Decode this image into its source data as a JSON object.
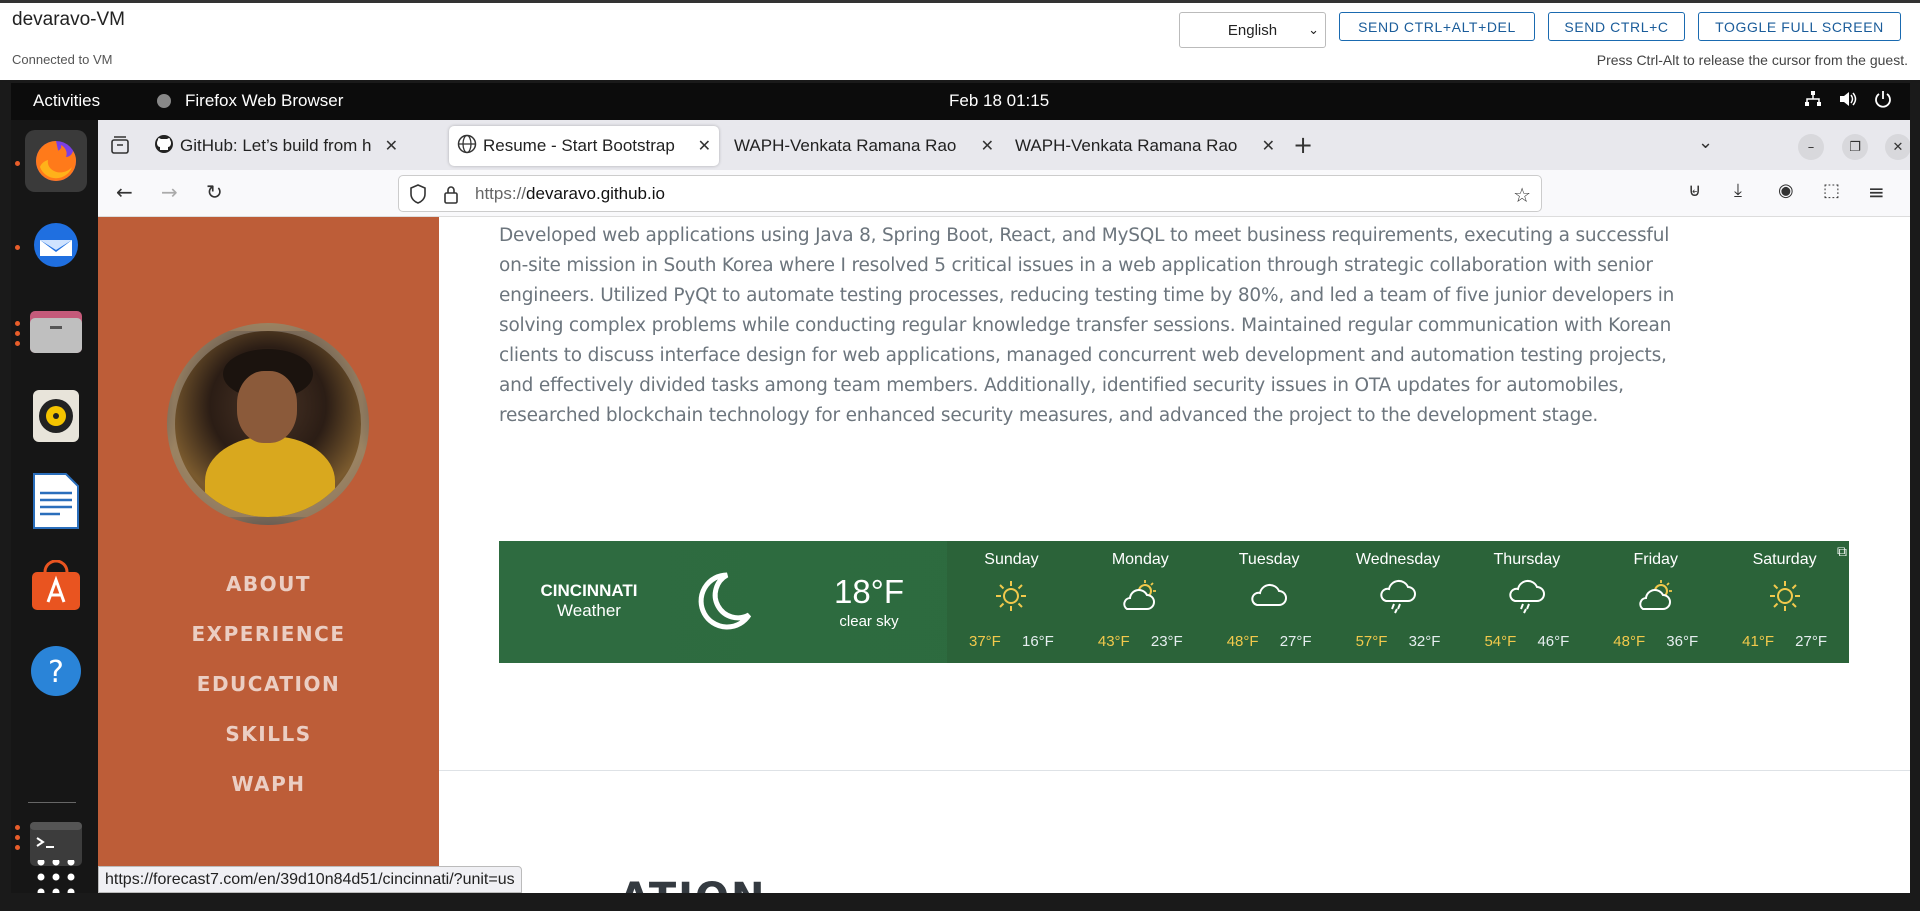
{
  "host": {
    "title": "devaravo-VM",
    "status": "Connected to VM",
    "language": "English",
    "buttons": [
      "SEND CTRL+ALT+DEL",
      "SEND CTRL+C",
      "TOGGLE FULL SCREEN"
    ],
    "hint": "Press Ctrl-Alt to release the cursor from the guest."
  },
  "gnome": {
    "activities": "Activities",
    "app_name": "Firefox Web Browser",
    "clock": "Feb 18  01:15",
    "tray_icons": [
      "network-icon",
      "volume-icon",
      "power-icon"
    ]
  },
  "dock": {
    "items": [
      "firefox-icon",
      "thunderbird-icon",
      "files-icon",
      "rhythmbox-icon",
      "writer-icon",
      "app-center-icon",
      "help-icon",
      "terminal-icon",
      "show-apps-icon"
    ]
  },
  "browser": {
    "tabs": [
      {
        "label": "GitHub: Let’s build from h"
      },
      {
        "label": "Resume - Start Bootstrap"
      },
      {
        "label": "WAPH-Venkata Ramana Rao"
      },
      {
        "label": "WAPH-Venkata Ramana Rao"
      }
    ],
    "url_prefix": "https://",
    "url_host": "devaravo.github.io",
    "status_url": "https://forecast7.com/en/39d10n84d51/cincinnati/?unit=us"
  },
  "page": {
    "nav": [
      "ABOUT",
      "EXPERIENCE",
      "EDUCATION",
      "SKILLS",
      "WAPH"
    ],
    "paragraph": "Developed web applications using Java 8, Spring Boot, React, and MySQL to meet business requirements, executing a successful on-site mission in South Korea where I resolved 5 critical issues in a web application through strategic collaboration with senior engineers. Utilized PyQt to automate testing processes, reducing testing time by 80%, and led a team of five junior developers in solving complex problems while conducting regular knowledge transfer sessions. Maintained regular communication with Korean clients to discuss interface design for web applications, managed concurrent web development and automation testing projects, and effectively divided tasks among team members. Additionally, identified security issues in OTA updates for automobiles, researched blockchain technology for enhanced security measures, and advanced the project to the development stage.",
    "next_heading_fragment": "ATION"
  },
  "weather": {
    "city": "CINCINNATI",
    "label": "Weather",
    "current_temp": "18°F",
    "current_desc": "clear sky",
    "current_icon": "moon-icon",
    "days": [
      {
        "name": "Sunday",
        "icon": "sun-icon",
        "hi": "37°F",
        "lo": "16°F"
      },
      {
        "name": "Monday",
        "icon": "partly-cloudy-icon",
        "hi": "43°F",
        "lo": "23°F"
      },
      {
        "name": "Tuesday",
        "icon": "cloud-icon",
        "hi": "48°F",
        "lo": "27°F"
      },
      {
        "name": "Wednesday",
        "icon": "rain-icon",
        "hi": "57°F",
        "lo": "32°F"
      },
      {
        "name": "Thursday",
        "icon": "rain-icon",
        "hi": "54°F",
        "lo": "46°F"
      },
      {
        "name": "Friday",
        "icon": "partly-cloudy-icon",
        "hi": "48°F",
        "lo": "36°F"
      },
      {
        "name": "Saturday",
        "icon": "sun-icon",
        "hi": "41°F",
        "lo": "27°F"
      }
    ]
  },
  "colors": {
    "sidebar": "#bd5d38",
    "weather_bg": "#2d6a3e",
    "temp_hi": "#f2c94c"
  }
}
